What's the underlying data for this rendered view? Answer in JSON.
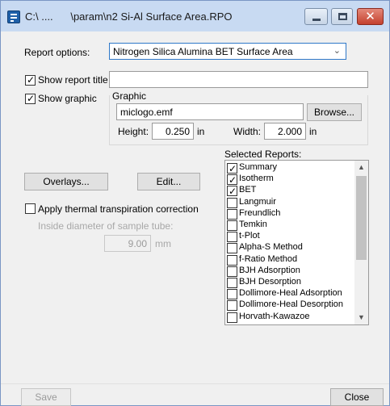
{
  "window": {
    "title": "C:\\ ....      \\param\\n2 Si-Al Surface Area.RPO",
    "close_glyph": "✕"
  },
  "report_options": {
    "label": "Report options:",
    "selected": "Nitrogen Silica Alumina BET Surface Area",
    "caret": "⌄"
  },
  "show_report_title": {
    "label": "Show report title",
    "checked": true,
    "value": ""
  },
  "show_graphic": {
    "label": "Show graphic",
    "checked": true
  },
  "graphic": {
    "group_label": "Graphic",
    "filename": "miclogo.emf",
    "browse_label": "Browse...",
    "height_label": "Height:",
    "height_value": "0.250",
    "height_unit": "in",
    "width_label": "Width:",
    "width_value": "2.000",
    "width_unit": "in"
  },
  "overlays_button": "Overlays...",
  "edit_button": "Edit...",
  "thermal": {
    "label": "Apply thermal transpiration correction",
    "checked": false,
    "diameter_label": "Inside diameter of sample tube:",
    "diameter_value": "9.00",
    "diameter_unit": "mm"
  },
  "selected_reports": {
    "label": "Selected Reports:",
    "items": [
      {
        "label": "Summary",
        "checked": true
      },
      {
        "label": "Isotherm",
        "checked": true
      },
      {
        "label": "BET",
        "checked": true
      },
      {
        "label": "Langmuir",
        "checked": false
      },
      {
        "label": "Freundlich",
        "checked": false
      },
      {
        "label": "Temkin",
        "checked": false
      },
      {
        "label": "t-Plot",
        "checked": false
      },
      {
        "label": "Alpha-S Method",
        "checked": false
      },
      {
        "label": "f-Ratio Method",
        "checked": false
      },
      {
        "label": "BJH Adsorption",
        "checked": false
      },
      {
        "label": "BJH Desorption",
        "checked": false
      },
      {
        "label": "Dollimore-Heal Adsorption",
        "checked": false
      },
      {
        "label": "Dollimore-Heal Desorption",
        "checked": false
      },
      {
        "label": "Horvath-Kawazoe",
        "checked": false
      }
    ],
    "scroll_up": "▲",
    "scroll_down": "▼"
  },
  "footer": {
    "save_label": "Save",
    "close_label": "Close"
  },
  "tick_glyph": "✓"
}
